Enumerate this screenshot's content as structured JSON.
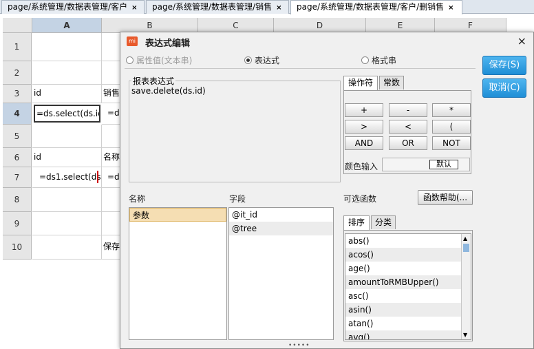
{
  "tabs": [
    {
      "label": "page/系统管理/数据表管理/客户",
      "close": "×"
    },
    {
      "label": "page/系统管理/数据表管理/销售",
      "close": "×"
    },
    {
      "label": "page/系统管理/数据表管理/客户/删销售",
      "close": "×"
    }
  ],
  "sheet": {
    "columns": [
      "A",
      "B",
      "C",
      "D",
      "E",
      "F"
    ],
    "rows": [
      "1",
      "2",
      "3",
      "4",
      "5",
      "6",
      "7",
      "8",
      "9",
      "10"
    ],
    "cells": {
      "a3": "id",
      "b3": "销售人",
      "a4": "=ds.select(ds.id)",
      "b4": "=d",
      "a6": "id",
      "b6": "名称",
      "a7": "=ds1.select(ds",
      "b7": "=d",
      "b10": "保存"
    }
  },
  "dialog": {
    "title": "表达式编辑",
    "icon": "mi",
    "close": "×",
    "radios": [
      {
        "label": "属性值(文本串)",
        "checked": false,
        "disabled": true
      },
      {
        "label": "表达式",
        "checked": true,
        "disabled": false
      },
      {
        "label": "格式串",
        "checked": false,
        "disabled": false
      }
    ],
    "expr_legend": "报表表达式",
    "expression": "save.delete(ds.id)",
    "op_tabs": [
      "操作符",
      "常数"
    ],
    "operators": [
      "+",
      "-",
      "*",
      ">",
      "<",
      "(",
      "AND",
      "OR",
      "NOT"
    ],
    "color_label": "颜色输入",
    "color_value": "默认",
    "save_label": "保存(S)",
    "cancel_label": "取消(C)",
    "name_header": "名称",
    "field_header": "字段",
    "func_header": "可选函数",
    "func_help": "函数帮助(...",
    "names": [
      "参数"
    ],
    "fields": [
      "@it_id",
      "@tree"
    ],
    "func_tabs": [
      "排序",
      "分类"
    ],
    "functions": [
      "abs()",
      "acos()",
      "age()",
      "amountToRMBUpper()",
      "asc()",
      "asin()",
      "atan()",
      "avg()"
    ],
    "resize_grip": "•••••"
  },
  "colors": {
    "accent": "#1f8ed6",
    "icon": "#e8592b",
    "selection": "#f5deb3",
    "header_selected": "#c4d3e4"
  }
}
